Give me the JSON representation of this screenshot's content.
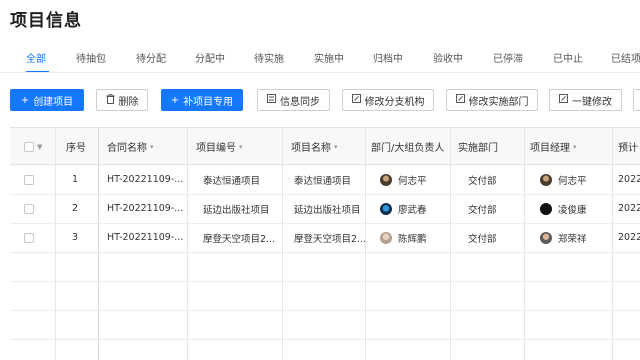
{
  "page": {
    "title": "项目信息"
  },
  "tabs": [
    {
      "label": "全部",
      "active": true
    },
    {
      "label": "待抽包"
    },
    {
      "label": "待分配"
    },
    {
      "label": "分配中"
    },
    {
      "label": "待实施"
    },
    {
      "label": "实施中"
    },
    {
      "label": "归档中"
    },
    {
      "label": "验收中"
    },
    {
      "label": "已停滞"
    },
    {
      "label": "已中止"
    },
    {
      "label": "已结项"
    }
  ],
  "toolbar": {
    "create": {
      "label": "创建项目",
      "icon": "+"
    },
    "delete": {
      "label": "删除",
      "icon": "trash-icon"
    },
    "supplement": {
      "label": "补项目专用",
      "icon": "+"
    },
    "sync": {
      "label": "信息同步",
      "icon": "sync-icon"
    },
    "branch": {
      "label": "修改分支机构",
      "icon": "edit-icon"
    },
    "dept": {
      "label": "修改实施部门",
      "icon": "edit-icon"
    },
    "bulk": {
      "label": "一键修改",
      "icon": "edit-icon"
    }
  },
  "table": {
    "headers": {
      "index": "序号",
      "contract": "合同名称",
      "code": "项目编号",
      "name": "项目名称",
      "dept_lead": "部门/大组负责人",
      "impl_dept": "实施部门",
      "manager": "项目经理",
      "plan": "预计"
    },
    "rows": [
      {
        "index": "1",
        "contract": "HT-20221109-...",
        "code": "泰达恒通项目",
        "name": "泰达恒通项目",
        "dept_lead": "何志平",
        "impl_dept": "交付部",
        "manager": "何志平",
        "plan": "2022-"
      },
      {
        "index": "2",
        "contract": "HT-20221109-...",
        "code": "延边出版社项目",
        "name": "延边出版社项目",
        "dept_lead": "廖武春",
        "impl_dept": "交付部",
        "manager": "凌俊康",
        "plan": "2022-"
      },
      {
        "index": "3",
        "contract": "HT-20221109-...",
        "code": "摩登天空项目2...",
        "name": "摩登天空项目2...",
        "dept_lead": "陈辉鹏",
        "impl_dept": "交付部",
        "manager": "郑荣祥",
        "plan": "2022-"
      }
    ]
  },
  "colors": {
    "accent": "#1677ff",
    "header_bg": "#f7f8fa"
  }
}
